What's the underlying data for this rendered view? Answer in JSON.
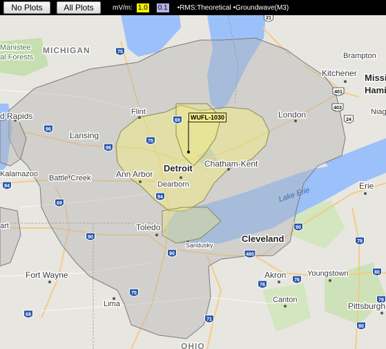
{
  "toolbar": {
    "no_plots_label": "No Plots",
    "all_plots_label": "All Plots",
    "mv_label": "mV/m:",
    "value_primary": "1.0",
    "value_secondary": "0.1",
    "rms_text": "•RMS:Theoretical •Groundwave(M3)"
  },
  "station": {
    "callsign": "WUFL-1030"
  },
  "places": {
    "detroit": "Detroit",
    "cleveland": "Cleveland",
    "chatham_kent": "Chatham-Kent",
    "ann_arbor": "Ann Arbor",
    "dearborn": "Dearborn",
    "toledo": "Toledo",
    "flint": "Flint",
    "lansing": "Lansing",
    "london": "London",
    "kitchener": "Kitchener",
    "brampton": "Brampton",
    "missi": "Missi",
    "hamil": "Hamil",
    "niag": "Niag",
    "erie": "Erie",
    "fort_wayne": "Fort Wayne",
    "lima": "Lima",
    "akron": "Akron",
    "youngstown": "Youngstown",
    "canton": "Canton",
    "pittsburgh": "Pittsburgh",
    "sandusky": "Sandusky",
    "battle_creek": "Battle Creek",
    "kalamazoo": "Kalamazoo",
    "rapids": "d Rapids",
    "manistee": "Manistee",
    "forests": "al Forests",
    "art": "art",
    "michigan": "MICHIGAN",
    "ohio": "OHIO",
    "lake_erie": "Lake Erie"
  },
  "highways": [
    "75",
    "96",
    "69",
    "96",
    "75",
    "94",
    "69",
    "94",
    "90",
    "75",
    "90",
    "90",
    "69",
    "480",
    "80",
    "76",
    "76",
    "71",
    "79",
    "80",
    "79",
    "21",
    "401",
    "403",
    "24"
  ],
  "colors": {
    "land": "#e8e6e1",
    "water": "#9cc0f9",
    "coverage_outer": "#d7d7d7",
    "coverage_inner": "#ecea9f",
    "parks": "#c8dfb0"
  }
}
